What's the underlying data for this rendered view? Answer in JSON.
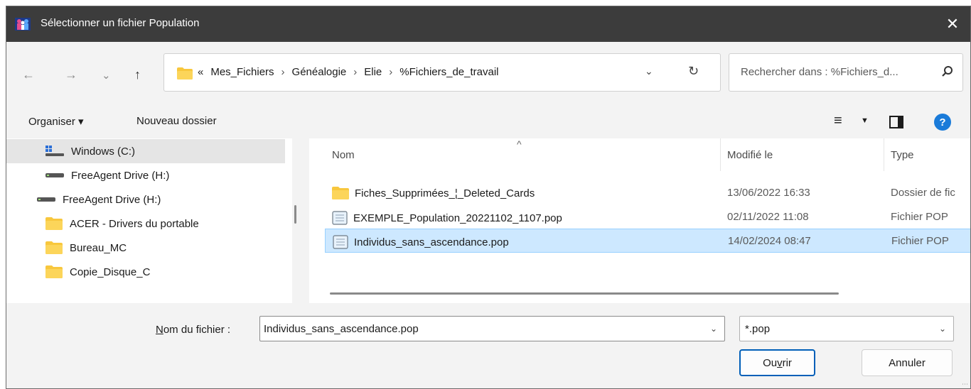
{
  "window": {
    "title": "Sélectionner un fichier Population",
    "close_symbol": "✕",
    "app_icon": "people-icon"
  },
  "nav": {
    "back": "←",
    "forward": "→",
    "recent": "⌄",
    "up": "↑",
    "breadcrumb": {
      "overflow": "«",
      "parts": [
        "Mes_Fichiers",
        "Généalogie",
        "Elie",
        "%Fichiers_de_travail"
      ],
      "separator": "›"
    },
    "dropdown": "⌄",
    "refresh": "↻",
    "search_placeholder": "Rechercher dans : %Fichiers_d..."
  },
  "toolbar": {
    "organize_label": "Organiser ▾",
    "new_folder_label": "Nouveau dossier",
    "view_icon": "≡",
    "view_dropdown": "▼",
    "help": "?"
  },
  "sidebar": {
    "items": [
      {
        "label": "Windows  (C:)",
        "icon": "windows-drive-icon",
        "selected": true
      },
      {
        "label": "FreeAgent Drive (H:)",
        "icon": "drive-icon"
      },
      {
        "label": "FreeAgent Drive (H:)",
        "icon": "drive-icon"
      },
      {
        "label": "ACER - Drivers du portable",
        "icon": "folder-icon"
      },
      {
        "label": "Bureau_MC",
        "icon": "folder-icon"
      },
      {
        "label": "Copie_Disque_C",
        "icon": "folder-icon"
      }
    ]
  },
  "filelist": {
    "sort_caret": "^",
    "columns": {
      "name": "Nom",
      "modified": "Modifié le",
      "type": "Type"
    },
    "rows": [
      {
        "name": "Fiches_Supprimées_¦_Deleted_Cards",
        "modified": "13/06/2022 16:33",
        "type": "Dossier de fic",
        "icon": "folder-icon"
      },
      {
        "name": "EXEMPLE_Population_20221102_1107.pop",
        "modified": "02/11/2022 11:08",
        "type": "Fichier POP",
        "icon": "file-icon"
      },
      {
        "name": "Individus_sans_ascendance.pop",
        "modified": "14/02/2024 08:47",
        "type": "Fichier POP",
        "icon": "file-icon",
        "selected": true
      }
    ]
  },
  "footer": {
    "filename_label_prefix": "N",
    "filename_label_rest": "om du fichier :",
    "filename_value": "Individus_sans_ascendance.pop",
    "filter_value": "*.pop",
    "dropdown": "⌄",
    "open_prefix": "Ou",
    "open_underline": "v",
    "open_suffix": "rir",
    "cancel_label": "Annuler"
  },
  "colors": {
    "titlebar": "#3c3c3c",
    "selection": "#cde8ff",
    "accent": "#005fb8",
    "folder": "#f8c73d"
  }
}
